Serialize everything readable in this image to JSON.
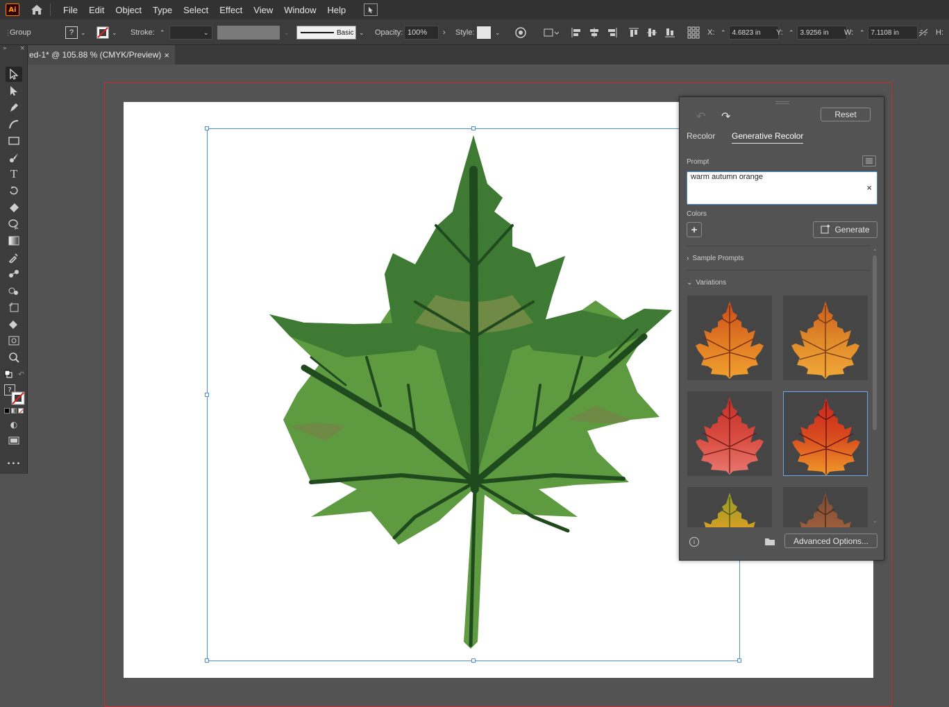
{
  "menubar": {
    "logo": "Ai",
    "items": [
      "File",
      "Edit",
      "Object",
      "Type",
      "Select",
      "Effect",
      "View",
      "Window",
      "Help"
    ]
  },
  "controlbar": {
    "selection_type": "Group",
    "fill_value": "?",
    "stroke_label": "Stroke:",
    "brush_label": "Basic",
    "opacity_label": "Opacity:",
    "opacity_value": "100%",
    "style_label": "Style:",
    "x_label": "X:",
    "x_value": "4.6823 in",
    "y_label": "Y:",
    "y_value": "3.9256 in",
    "w_label": "W:",
    "w_value": "7.1108 in",
    "h_label": "H:"
  },
  "document": {
    "tab_title": "ed-1* @ 105.88 % (CMYK/Preview)",
    "close": "×"
  },
  "toolbar": {
    "fill_value": "?",
    "more": "•••"
  },
  "panel": {
    "reset_label": "Reset",
    "tabs": [
      "Recolor",
      "Generative Recolor"
    ],
    "active_tab": "Generative Recolor",
    "prompt_label": "Prompt",
    "prompt_value": "warm autumn orange",
    "clear": "×",
    "colors_label": "Colors",
    "add": "+",
    "generate_label": "Generate",
    "sample_prompts_label": "Sample Prompts",
    "variations_label": "Variations",
    "advanced_label": "Advanced Options...",
    "info": "i",
    "variations": [
      {
        "name": "orange-red",
        "top": "#c84a1e",
        "mid": "#e07a22",
        "bot": "#f0a030",
        "vein": "#7a2a10"
      },
      {
        "name": "orange",
        "top": "#c85a20",
        "mid": "#e08a2a",
        "bot": "#f0a838",
        "vein": "#7a3a10"
      },
      {
        "name": "red-pink",
        "top": "#c0302a",
        "mid": "#d84a3e",
        "bot": "#e87870",
        "vein": "#701818"
      },
      {
        "name": "red-orange",
        "top": "#c8241e",
        "mid": "#d84a1e",
        "bot": "#f09a28",
        "vein": "#6a1010"
      },
      {
        "name": "yellow-green",
        "top": "#8a9a30",
        "mid": "#e0a020",
        "bot": "#f0c030",
        "vein": "#4a5a10"
      },
      {
        "name": "brown",
        "top": "#7a4a38",
        "mid": "#a0603a",
        "bot": "#c08a40",
        "vein": "#4a2a18"
      }
    ]
  }
}
